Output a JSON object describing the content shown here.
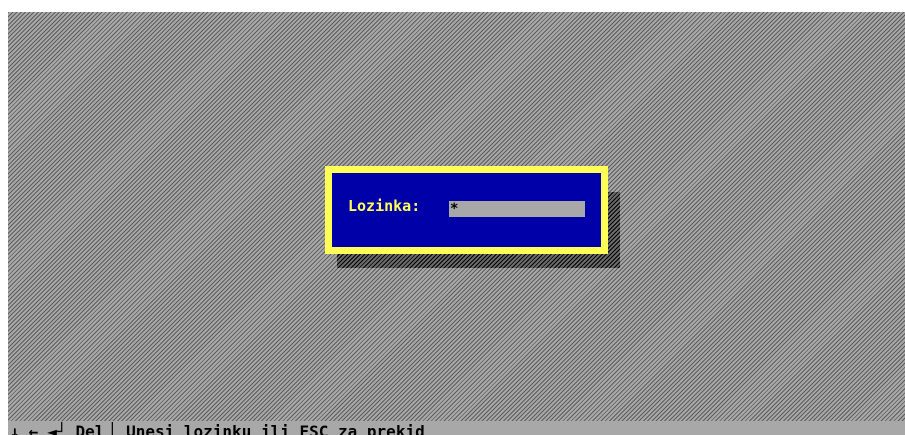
{
  "dialog": {
    "label": "Lozinka:",
    "password_value": "*"
  },
  "status_bar": {
    "keys": [
      "↓",
      "←",
      "◄┘",
      "Del"
    ],
    "separator": "│",
    "hint": "Unesi lozinku ili ESC za prekid"
  },
  "colors": {
    "dialog_background": "#0000a8",
    "dialog_border": "#ffff55",
    "label_text": "#ffff55",
    "field_background": "#a8a8a8",
    "desktop_pattern": "#5c5c5c"
  }
}
